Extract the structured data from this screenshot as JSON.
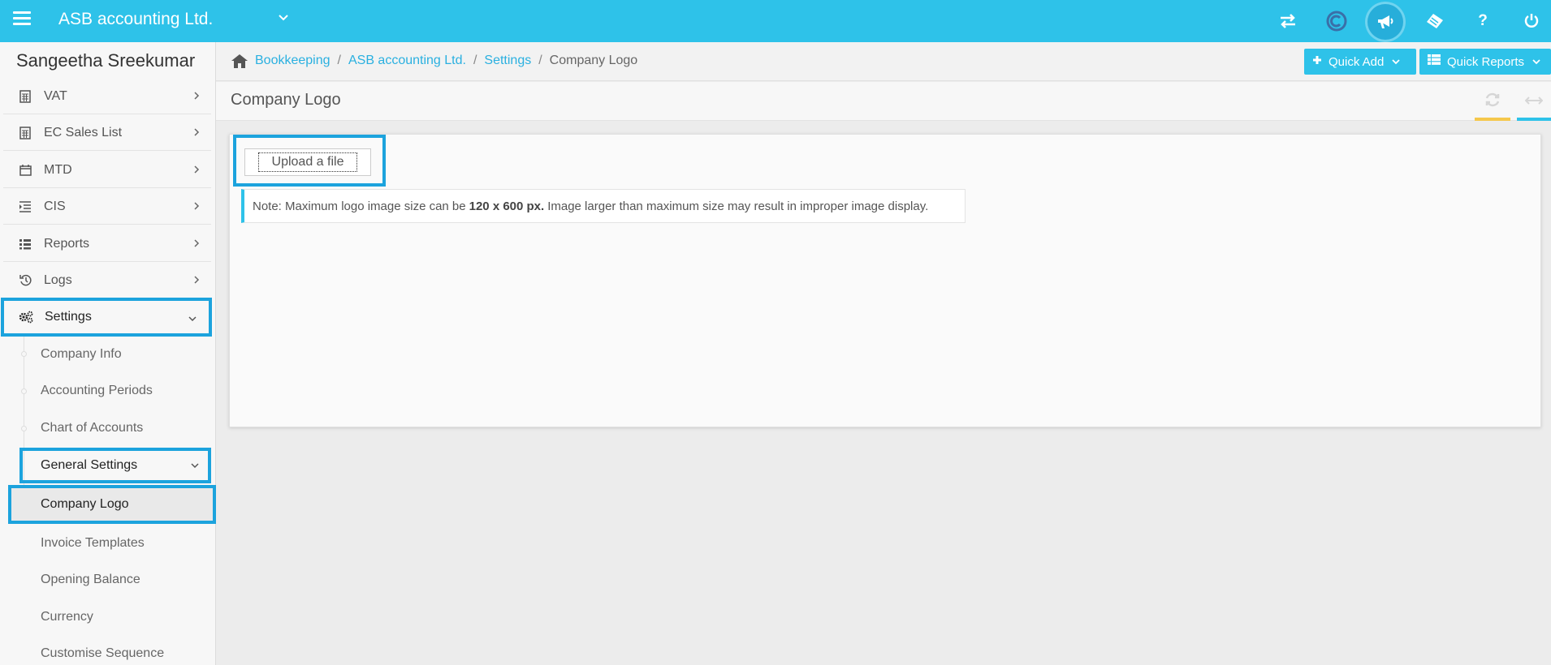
{
  "topbar": {
    "company_name": "ASB accounting Ltd.",
    "icons": [
      "menu-icon",
      "transfer-icon",
      "c-logo-icon",
      "megaphone-icon",
      "ticket-icon",
      "help-icon",
      "power-icon"
    ],
    "help_glyph": "?",
    "accent_color": "#2ec2e9"
  },
  "sidebar": {
    "user_name": "Sangeetha Sreekumar",
    "items": [
      {
        "label": "VAT",
        "icon": "calculator-icon"
      },
      {
        "label": "EC Sales List",
        "icon": "calculator-icon"
      },
      {
        "label": "MTD",
        "icon": "calendar-icon"
      },
      {
        "label": "CIS",
        "icon": "indent-icon"
      },
      {
        "label": "Reports",
        "icon": "list-icon"
      },
      {
        "label": "Logs",
        "icon": "history-icon"
      },
      {
        "label": "Settings",
        "icon": "cogs-icon"
      }
    ],
    "settings_sub": [
      {
        "label": "Company Info"
      },
      {
        "label": "Accounting Periods"
      },
      {
        "label": "Chart of Accounts"
      },
      {
        "label": "General Settings"
      },
      {
        "label": "Company Logo"
      },
      {
        "label": "Invoice Templates"
      },
      {
        "label": "Opening Balance"
      },
      {
        "label": "Currency"
      },
      {
        "label": "Customise Sequence"
      }
    ]
  },
  "breadcrumb": {
    "items": [
      "Bookkeeping",
      "ASB accounting Ltd.",
      "Settings"
    ],
    "current": "Company Logo",
    "separator": "/"
  },
  "buttons": {
    "quick_add": "Quick Add",
    "quick_reports": "Quick Reports"
  },
  "page": {
    "title": "Company Logo",
    "upload_label": "Upload a file",
    "note_prefix": "Note: Maximum logo image size can be",
    "note_bold": "120 x 600 px.",
    "note_suffix": "Image larger than maximum size may result in improper image display."
  }
}
